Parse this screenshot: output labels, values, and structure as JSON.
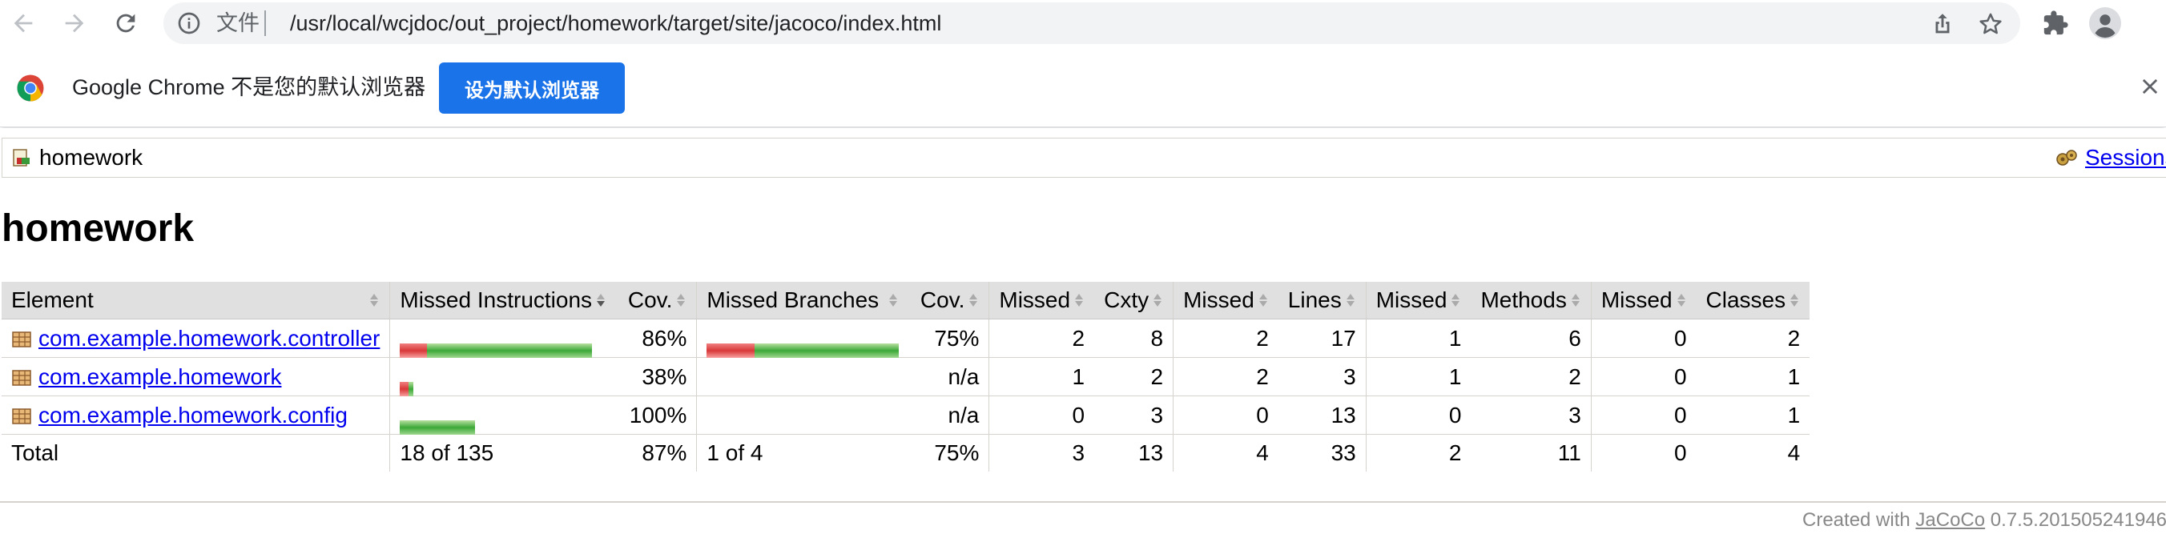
{
  "browser": {
    "chip_label": "文件",
    "url": "/usr/local/wcjdoc/out_project/homework/target/site/jacoco/index.html"
  },
  "infobar": {
    "message": "Google Chrome 不是您的默认浏览器",
    "button": "设为默认浏览器"
  },
  "breadcrumb": {
    "label": "homework",
    "sessions": "Sessions"
  },
  "page_title": "homework",
  "table": {
    "headers": [
      "Element",
      "Missed Instructions",
      "Cov.",
      "Missed Branches",
      "Cov.",
      "Missed",
      "Cxty",
      "Missed",
      "Lines",
      "Missed",
      "Methods",
      "Missed",
      "Classes"
    ],
    "rows": [
      {
        "element": "com.example.homework.controller",
        "instr_missed_fraction": 0.14,
        "instr_bar_total": 1.0,
        "instr_cov": "86%",
        "branch_missed_fraction": 0.25,
        "branch_bar_total": 1.0,
        "branch_cov": "75%",
        "cxty_missed": "2",
        "cxty": "8",
        "lines_missed": "2",
        "lines": "17",
        "methods_missed": "1",
        "methods": "6",
        "classes_missed": "0",
        "classes": "2"
      },
      {
        "element": "com.example.homework",
        "instr_missed_fraction": 0.62,
        "instr_bar_total": 0.07,
        "instr_cov": "38%",
        "branch_missed_fraction": null,
        "branch_bar_total": 0,
        "branch_cov": "n/a",
        "cxty_missed": "1",
        "cxty": "2",
        "lines_missed": "2",
        "lines": "3",
        "methods_missed": "1",
        "methods": "2",
        "classes_missed": "0",
        "classes": "1"
      },
      {
        "element": "com.example.homework.config",
        "instr_missed_fraction": 0.0,
        "instr_bar_total": 0.39,
        "instr_cov": "100%",
        "branch_missed_fraction": null,
        "branch_bar_total": 0,
        "branch_cov": "n/a",
        "cxty_missed": "0",
        "cxty": "3",
        "lines_missed": "0",
        "lines": "13",
        "methods_missed": "0",
        "methods": "3",
        "classes_missed": "0",
        "classes": "1"
      }
    ],
    "total": {
      "label": "Total",
      "instr": "18 of 135",
      "instr_cov": "87%",
      "branch": "1 of 4",
      "branch_cov": "75%",
      "cxty_missed": "3",
      "cxty": "13",
      "lines_missed": "4",
      "lines": "33",
      "methods_missed": "2",
      "methods": "11",
      "classes_missed": "0",
      "classes": "4"
    }
  },
  "footer": {
    "prefix": "Created with",
    "link": "JaCoCo",
    "version": "0.7.5.201505241946"
  },
  "colors": {
    "accent": "#1a73e8",
    "link": "#0000ee",
    "bar_missed": "#d83838",
    "bar_covered": "#3ca838",
    "header_bg": "#e0e0e0"
  }
}
